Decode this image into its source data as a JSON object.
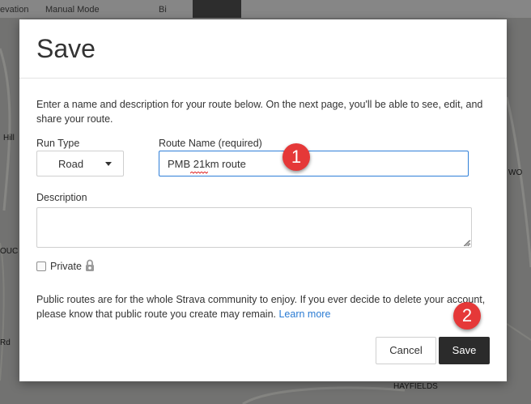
{
  "topbar": {
    "item1": "evation",
    "item2": "Manual Mode",
    "item3": "Bi"
  },
  "map": {
    "label_left": "Hill",
    "label_left2": "OUC",
    "label_left3": "Rd",
    "label_right": "WO",
    "label_bottom": "HAYFIELDS"
  },
  "dialog": {
    "title": "Save",
    "intro": "Enter a name and description for your route below. On the next page, you'll be able to see, edit, and share your route.",
    "run_type_label": "Run Type",
    "run_type_value": "Road",
    "route_name_label": "Route Name (required)",
    "route_name_value": "PMB 21km route",
    "description_label": "Description",
    "description_value": "",
    "private_label": "Private",
    "public_text": "Public routes are for the whole Strava community to enjoy. If you ever decide to delete your account, please know that public route you create may remain.",
    "learn_more": "Learn more",
    "cancel_label": "Cancel",
    "save_label": "Save"
  },
  "annotations": {
    "step1": "1",
    "step2": "2"
  },
  "colors": {
    "badge": "#e53838",
    "link": "#2a7bd3",
    "save_button": "#2b2b2b",
    "input_focus": "#2f7fd8"
  }
}
